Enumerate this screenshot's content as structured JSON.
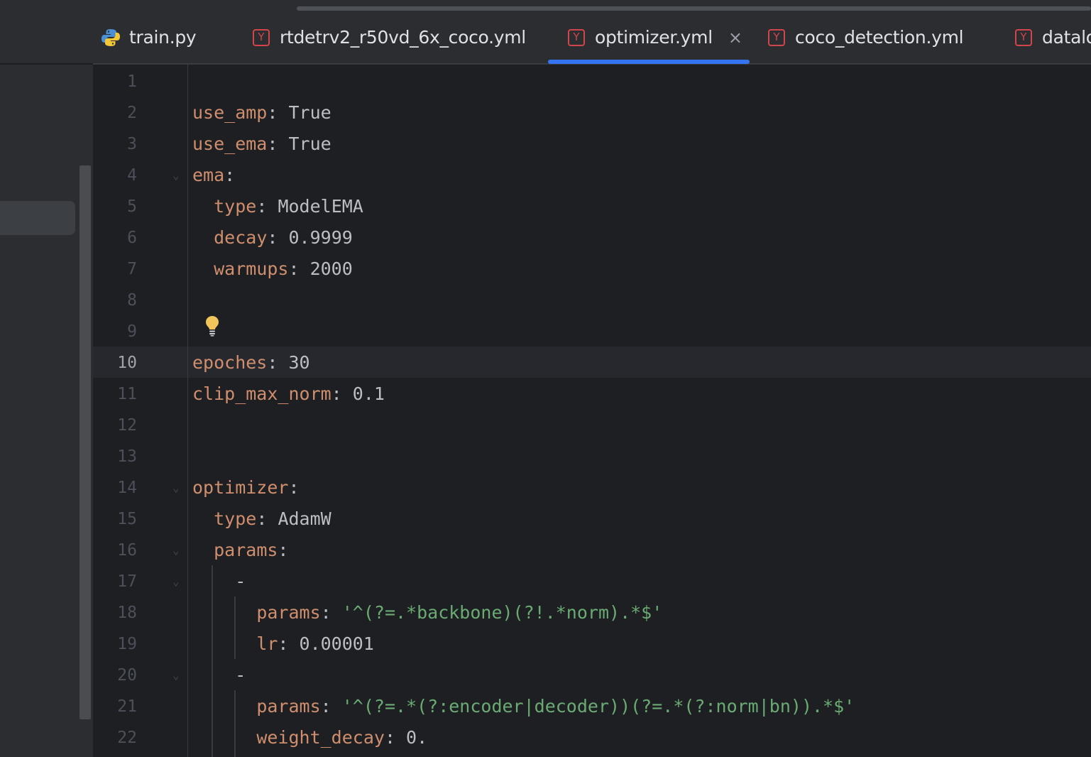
{
  "tabs": [
    {
      "label": "train.py",
      "icon": "python-file-icon",
      "active": false
    },
    {
      "label": "rtdetrv2_r50vd_6x_coco.yml",
      "icon": "yaml-file-icon",
      "active": false
    },
    {
      "label": "optimizer.yml",
      "icon": "yaml-file-icon",
      "active": true
    },
    {
      "label": "coco_detection.yml",
      "icon": "yaml-file-icon",
      "active": false
    },
    {
      "label": "datalo",
      "icon": "yaml-file-icon",
      "active": false
    }
  ],
  "yml_icon_glyph": "Y",
  "close_glyph": "×",
  "colors": {
    "key": "#cf8e6d",
    "string": "#6aab73",
    "plain": "#bcbec4",
    "accent": "#3574f0",
    "yaml_icon": "#d0464a"
  },
  "editor": {
    "current_line": 10,
    "lines": [
      {
        "n": "1"
      },
      {
        "n": "2",
        "key": "use_amp",
        "sep": ": ",
        "val": "True"
      },
      {
        "n": "3",
        "key": "use_ema",
        "sep": ": ",
        "val": "True"
      },
      {
        "n": "4",
        "key": "ema",
        "sep": ":",
        "fold": true
      },
      {
        "n": "5",
        "indent": "  ",
        "key": "type",
        "sep": ": ",
        "val": "ModelEMA"
      },
      {
        "n": "6",
        "indent": "  ",
        "key": "decay",
        "sep": ": ",
        "val": "0.9999"
      },
      {
        "n": "7",
        "indent": "  ",
        "key": "warmups",
        "sep": ": ",
        "val": "2000"
      },
      {
        "n": "8"
      },
      {
        "n": "9"
      },
      {
        "n": "10",
        "key": "epoches",
        "sep": ": ",
        "val": "30"
      },
      {
        "n": "11",
        "key": "clip_max_norm",
        "sep": ": ",
        "val": "0.1"
      },
      {
        "n": "12"
      },
      {
        "n": "13"
      },
      {
        "n": "14",
        "key": "optimizer",
        "sep": ":",
        "fold": true
      },
      {
        "n": "15",
        "indent": "  ",
        "key": "type",
        "sep": ": ",
        "val": "AdamW"
      },
      {
        "n": "16",
        "indent": "  ",
        "key": "params",
        "sep": ":",
        "fold": true
      },
      {
        "n": "17",
        "indent": "    ",
        "val": "-",
        "fold": true
      },
      {
        "n": "18",
        "indent": "      ",
        "key": "params",
        "sep": ": ",
        "str": "'^(?=.*backbone)(?!.*norm).*$'"
      },
      {
        "n": "19",
        "indent": "      ",
        "key": "lr",
        "sep": ": ",
        "val": "0.00001"
      },
      {
        "n": "20",
        "indent": "    ",
        "val": "-",
        "fold": true
      },
      {
        "n": "21",
        "indent": "      ",
        "key": "params",
        "sep": ": ",
        "str": "'^(?=.*(?:encoder|decoder))(?=.*(?:norm|bn)).*$'"
      },
      {
        "n": "22",
        "indent": "      ",
        "key": "weight_decay",
        "sep": ": ",
        "val": "0."
      }
    ]
  }
}
